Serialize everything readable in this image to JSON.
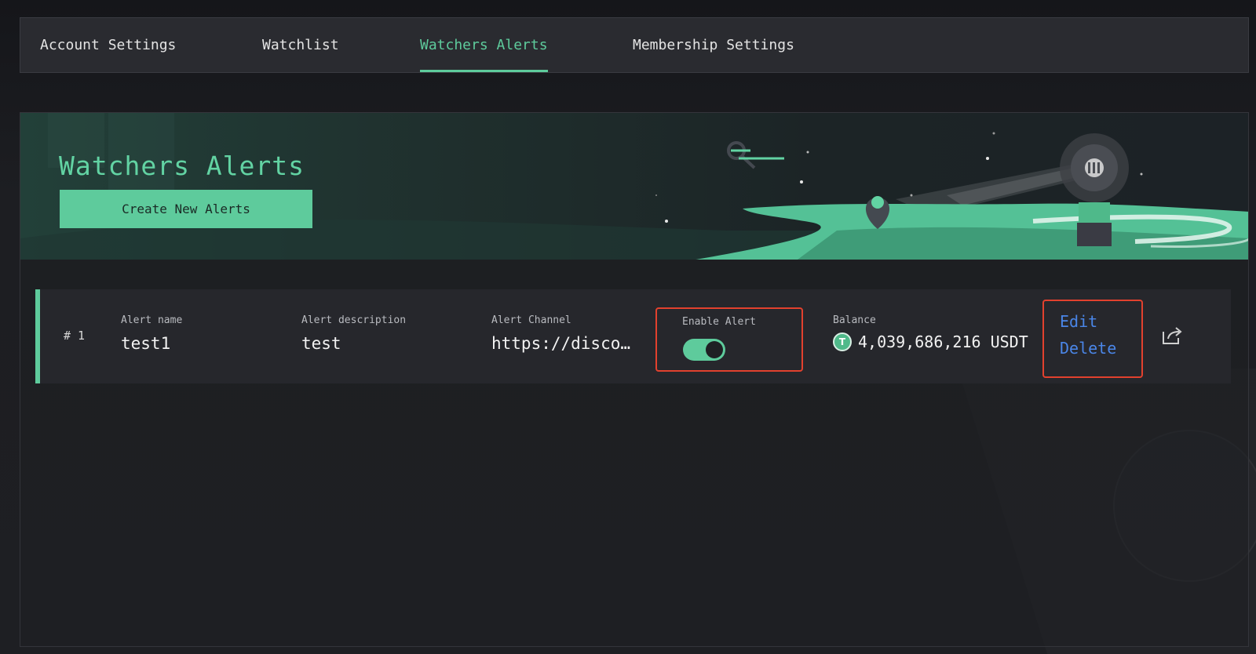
{
  "tabs": [
    {
      "label": "Account Settings"
    },
    {
      "label": "Watchlist"
    },
    {
      "label": "Watchers Alerts",
      "active": true
    },
    {
      "label": "Membership Settings"
    }
  ],
  "banner": {
    "title": "Watchers Alerts",
    "create_button_label": "Create New Alerts"
  },
  "alerts": [
    {
      "index": "# 1",
      "name_label": "Alert name",
      "name": "test1",
      "description_label": "Alert description",
      "description": "test",
      "channel_label": "Alert Channel",
      "channel": "https://disco…",
      "enable_label": "Enable Alert",
      "enabled": true,
      "balance_label": "Balance",
      "balance_coin_icon": "tether-coin-icon",
      "balance": "4,039,686,216 USDT",
      "edit_label": "Edit",
      "delete_label": "Delete"
    }
  ],
  "colors": {
    "accent": "#5ecb9c",
    "link": "#4a86e8",
    "highlight": "#e2412e",
    "background": "#1e1f23"
  }
}
